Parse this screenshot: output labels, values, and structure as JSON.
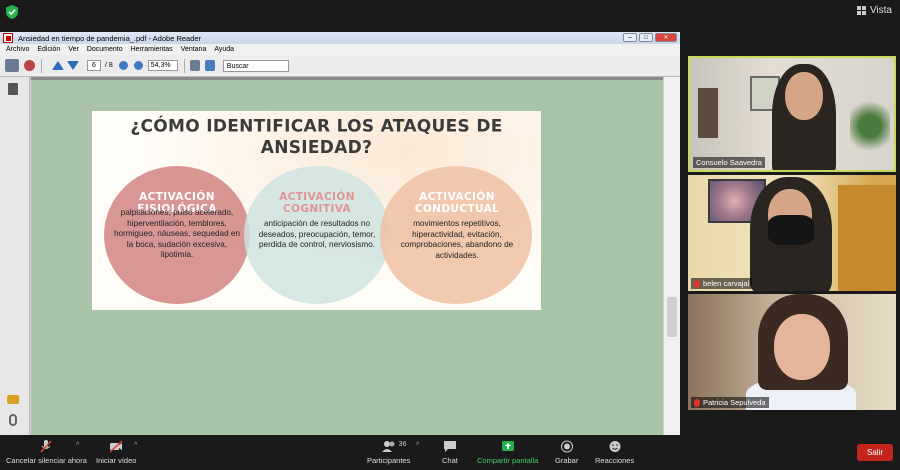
{
  "topbar": {
    "view_label": "Vista"
  },
  "reader": {
    "window_title": "Ansiedad en tiempo de pandemia_.pdf - Adobe Reader",
    "menu": [
      "Archivo",
      "Edición",
      "Ver",
      "Documento",
      "Herramientas",
      "Ventana",
      "Ayuda"
    ],
    "page_current": "6",
    "page_total": "/ 8",
    "zoom": "54,3%",
    "search_placeholder": "Buscar"
  },
  "slide": {
    "title": "¿CÓMO IDENTIFICAR LOS ATAQUES DE ANSIEDAD?",
    "sections": [
      {
        "title": "ACTIVACIÓN FISIOLÓGICA",
        "text": "palpitaciones, pulso acelerado, hiperventilación, temblores, hormigueo, náuseas, sequedad en la boca, sudación excesiva, lipotimia."
      },
      {
        "title": "ACTIVACIÓN COGNITIVA",
        "text": "anticipación de resultados no deseados, preocupación, temor, perdida de control, nerviosismo."
      },
      {
        "title": "ACTIVACIÓN CONDUCTUAL",
        "text": "movimientos repetitivos, hiperactividad, evitación, comprobaciones, abandono de actividades."
      }
    ],
    "colors": {
      "c1": "#d48b88",
      "c2": "#cfe4e0",
      "c3": "#f0c3a7"
    }
  },
  "participants": [
    {
      "name": "Consuelo Saavedra",
      "muted": false
    },
    {
      "name": "belen carvajal",
      "muted": true
    },
    {
      "name": "Patricia Sepulveda",
      "muted": true
    }
  ],
  "bottombar": {
    "mute": "Cancelar silenciar ahora",
    "video": "Iniciar vídeo",
    "participants": "Participantes",
    "participants_count": "36",
    "chat": "Chat",
    "share": "Compartir pantalla",
    "record": "Grabar",
    "reactions": "Reacciones",
    "leave": "Salir"
  }
}
